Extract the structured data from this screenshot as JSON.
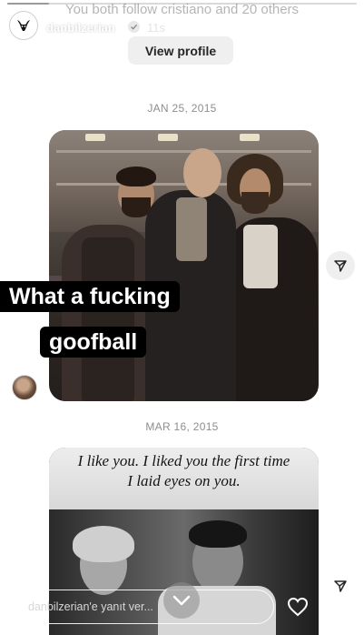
{
  "chat": {
    "follow_context": "You both follow cristiano and 20 others",
    "view_profile_label": "View profile"
  },
  "story": {
    "username": "danbilzerian",
    "time_ago": "11s",
    "progress": 0.12,
    "reply_placeholder": "danbilzerian'e yanıt ver..."
  },
  "messages": [
    {
      "date": "JAN 25, 2015",
      "caption_lines": [
        "What a fucking",
        "goofball"
      ]
    },
    {
      "date": "MAR 16, 2015",
      "quote_lines": [
        "I like you. I liked you the first time",
        "I laid eyes on you."
      ]
    }
  ],
  "icons": {
    "profile": "goat-logo-icon",
    "verified": "verified-badge-icon",
    "play": "play-icon",
    "mute": "mute-icon",
    "more": "more-icon",
    "share": "share-icon",
    "chevron": "chevron-down-icon",
    "like": "heart-icon",
    "send": "send-icon"
  }
}
